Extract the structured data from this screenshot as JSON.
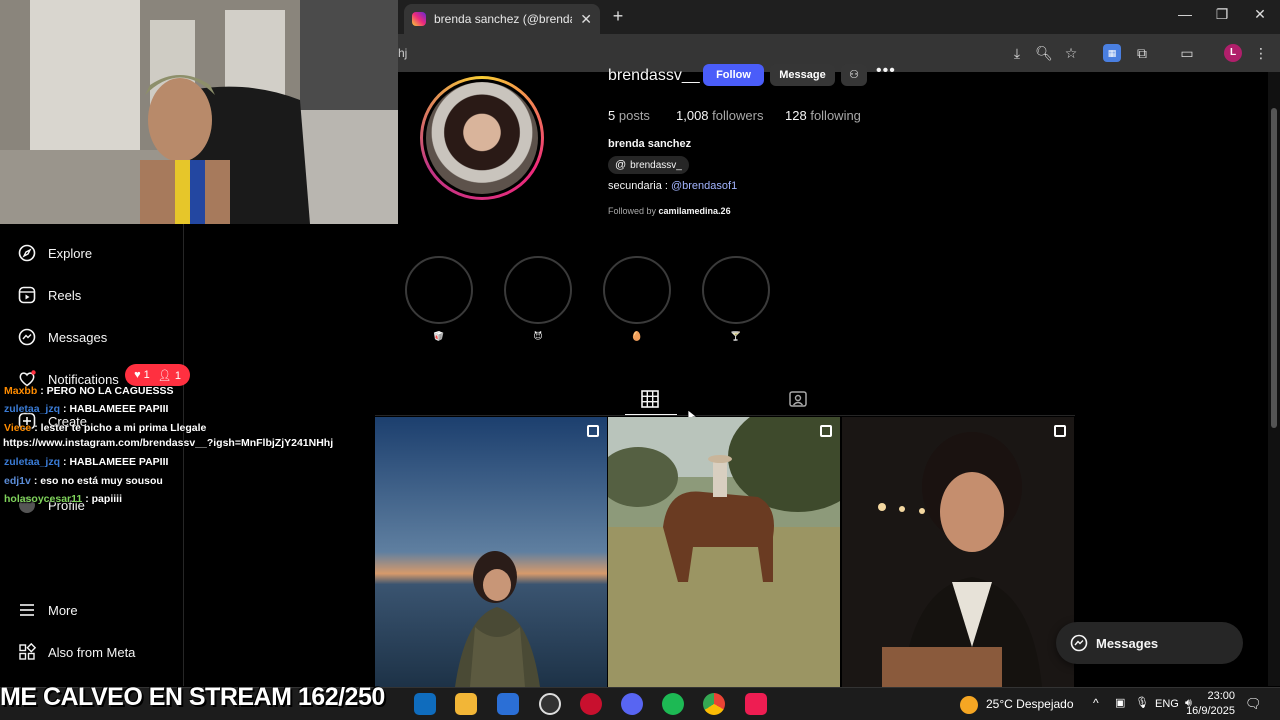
{
  "browser": {
    "tab_title": "brenda sanchez (@brendassv_",
    "omnibox_text": "hj",
    "profile_initial": "L"
  },
  "sidebar": {
    "items": [
      {
        "label": "Explore",
        "icon": "compass-icon"
      },
      {
        "label": "Reels",
        "icon": "reels-icon"
      },
      {
        "label": "Messages",
        "icon": "messenger-icon"
      },
      {
        "label": "Notifications",
        "icon": "heart-icon"
      },
      {
        "label": "Create",
        "icon": "plus-square-icon"
      },
      {
        "label": "Profile",
        "icon": "avatar-icon"
      },
      {
        "label": "More",
        "icon": "menu-icon"
      },
      {
        "label": "Also from Meta",
        "icon": "meta-grid-icon"
      }
    ],
    "notif_badge_likes": "1",
    "notif_badge_follows": "1"
  },
  "profile": {
    "username": "brendassv__",
    "follow_label": "Follow",
    "message_label": "Message",
    "posts_count": "5",
    "posts_label": "posts",
    "followers_count": "1,008",
    "followers_label": "followers",
    "following_count": "128",
    "following_label": "following",
    "full_name": "brenda sanchez",
    "threads_handle": "brendassv_",
    "bio_prefix": "secundaria : ",
    "bio_link": "@brendasof1",
    "followed_by_prefix": "Followed by ",
    "followed_by_user": "camilamedina.26",
    "highlights": [
      "🥡",
      "😈",
      "🥚",
      "🍸"
    ]
  },
  "chat": [
    {
      "user": "Maxbb",
      "color": "#ff8c00",
      "msg": ": PERO NO LA CAGUESSS"
    },
    {
      "user": "zuletaa_jzq",
      "color": "#3a7bd5",
      "msg": ": HABLAMEEE PAPIII"
    },
    {
      "user": "Viece",
      "color": "#ff8c00",
      "msg": ": lester te picho a mi prima Llegale"
    },
    {
      "user": "",
      "color": "#ffffff",
      "msg": "https://www.instagram.com/brendassv__?igsh=MnFlbjZjY241NHhj"
    },
    {
      "user": "zuletaa_jzq",
      "color": "#3a7bd5",
      "msg": ": HABLAMEEE PAPIII"
    },
    {
      "user": "edj1v",
      "color": "#5b8cd6",
      "msg": ": eso no está muy sousou"
    },
    {
      "user": "holasoycesar11",
      "color": "#7fd35b",
      "msg": ": papiiii"
    }
  ],
  "messages_fab": "Messages",
  "stream_banner": "ME CALVEO EN STREAM 162/250",
  "taskbar": {
    "weather": "25°C  Despejado",
    "lang": "ENG",
    "time": "23:00",
    "date": "16/9/2025"
  }
}
